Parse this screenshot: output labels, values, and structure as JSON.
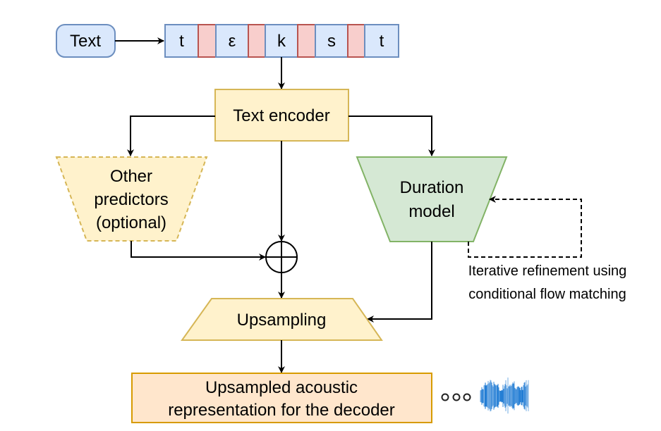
{
  "nodes": {
    "text_input": "Text",
    "tokens": [
      "t",
      "",
      "ε",
      "",
      "k",
      "",
      "s",
      "",
      "t"
    ],
    "text_encoder": "Text encoder",
    "other_predictors": [
      "Other",
      "predictors",
      "(optional)"
    ],
    "duration_model": [
      "Duration",
      "model"
    ],
    "upsampling": "Upsampling",
    "output": [
      "Upsampled acoustic",
      "representation for the decoder"
    ]
  },
  "annotations": {
    "refinement": [
      "Iterative refinement using",
      "conditional flow matching"
    ]
  },
  "colors": {
    "token_fill": "#dae8fc",
    "token_stroke": "#6c8ebf",
    "pad_fill": "#f8cecc",
    "pad_stroke": "#b85450",
    "yellow_fill": "#fff2cc",
    "yellow_stroke": "#d6b656",
    "green_fill": "#d5e8d4",
    "green_stroke": "#82b366",
    "orange_fill": "#ffe6cc",
    "orange_stroke": "#d79b00",
    "waveform": "#0b6fd0"
  }
}
